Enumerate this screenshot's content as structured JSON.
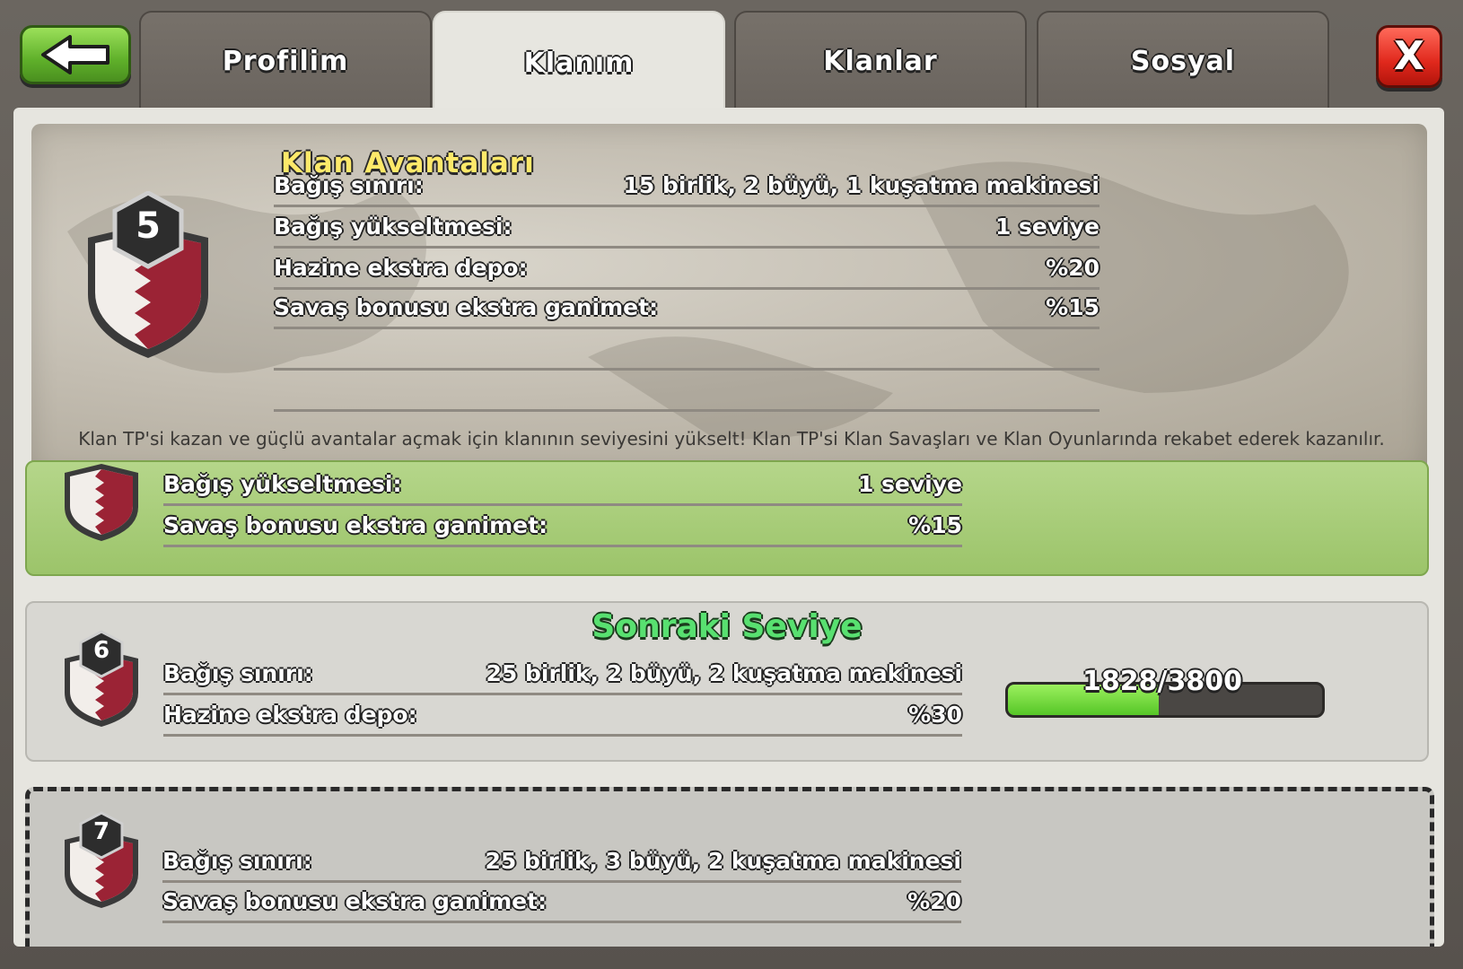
{
  "tabs": [
    {
      "label": "Profilim",
      "active": false
    },
    {
      "label": "Klanım",
      "active": true
    },
    {
      "label": "Klanlar",
      "active": false
    },
    {
      "label": "Sosyal",
      "active": false
    }
  ],
  "close_label": "X",
  "perks": {
    "title": "Klan Avantaları",
    "level": "5",
    "rows": [
      {
        "label": "Bağış sınırı:",
        "value": "15 birlik, 2 büyü, 1 kuşatma makinesi"
      },
      {
        "label": "Bağış yükseltmesi:",
        "value": "1 seviye"
      },
      {
        "label": "Hazine ekstra depo:",
        "value": "%20"
      },
      {
        "label": "Savaş bonusu ekstra ganimet:",
        "value": "%15"
      }
    ],
    "description": "Klan TP'si kazan ve güçlü avantalar açmak için klanının seviyesini yükselt! Klan TP'si Klan Savaşları ve Klan Oyunlarında rekabet ederek kazanılır."
  },
  "current_level": {
    "level": "5",
    "rows": [
      {
        "label": "Bağış yükseltmesi:",
        "value": "1 seviye"
      },
      {
        "label": "Savaş bonusu ekstra ganimet:",
        "value": "%15"
      }
    ]
  },
  "next_level": {
    "title": "Sonraki Seviye",
    "level": "6",
    "rows": [
      {
        "label": "Bağış sınırı:",
        "value": "25 birlik, 2 büyü, 2 kuşatma makinesi"
      },
      {
        "label": "Hazine ekstra depo:",
        "value": "%30"
      }
    ],
    "progress_text": "1828/3800",
    "progress_fraction": 0.481
  },
  "locked_level": {
    "level": "7",
    "rows": [
      {
        "label": "Bağış sınırı:",
        "value": "25 birlik, 3 büyü, 2 kuşatma makinesi"
      },
      {
        "label": "Savaş bonusu ekstra ganimet:",
        "value": "%20"
      }
    ]
  },
  "colors": {
    "title_yellow": "#fde96a",
    "next_title_green": "#58e070",
    "current_card": "#a8cd78",
    "progress_fill": "#56c627",
    "shield_red": "#9b2335"
  }
}
